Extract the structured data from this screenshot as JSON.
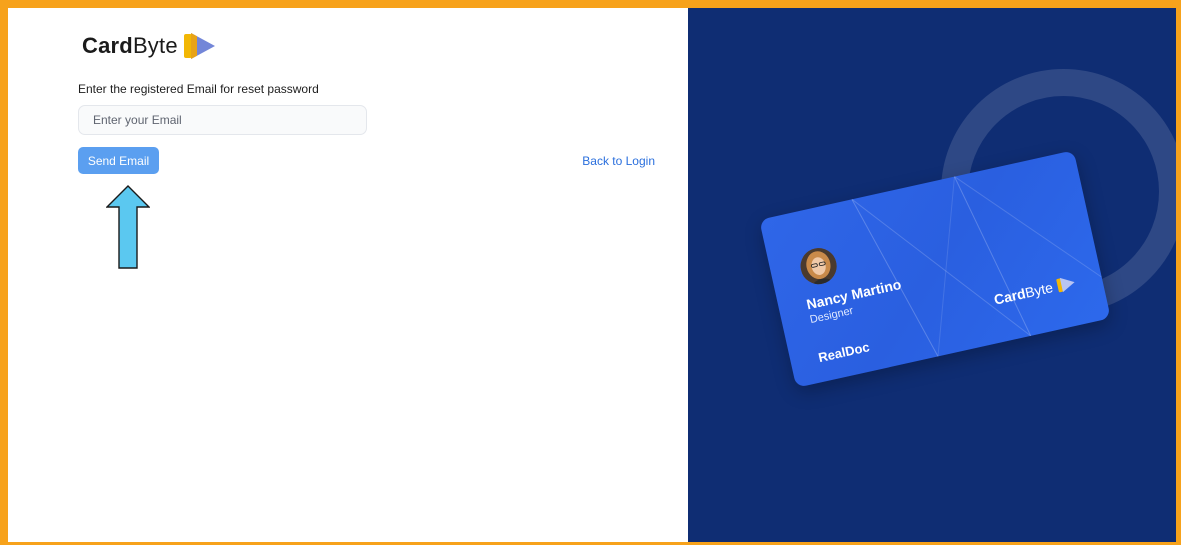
{
  "brand": {
    "name_bold": "Card",
    "name_light": "Byte",
    "colors": {
      "accent_yellow": "#f2b705",
      "accent_purple": "#6b7fd6",
      "frame_orange": "#f7a21b",
      "panel_navy": "#0f2d73",
      "card_blue": "#2f66e8",
      "button_blue": "#5b9ff0",
      "link_blue": "#2a6fdd"
    }
  },
  "form": {
    "instruction": "Enter the registered Email for reset password",
    "email_placeholder": "Enter your Email",
    "email_value": "",
    "send_label": "Send Email",
    "back_label": "Back to Login"
  },
  "card": {
    "name": "Nancy Martino",
    "role": "Designer",
    "company": "RealDoc",
    "brand_bold": "Card",
    "brand_light": "Byte"
  },
  "icons": {
    "logo_mark": "cardbyte-play-logo-icon",
    "annotation": "up-arrow-icon",
    "avatar": "user-avatar"
  }
}
